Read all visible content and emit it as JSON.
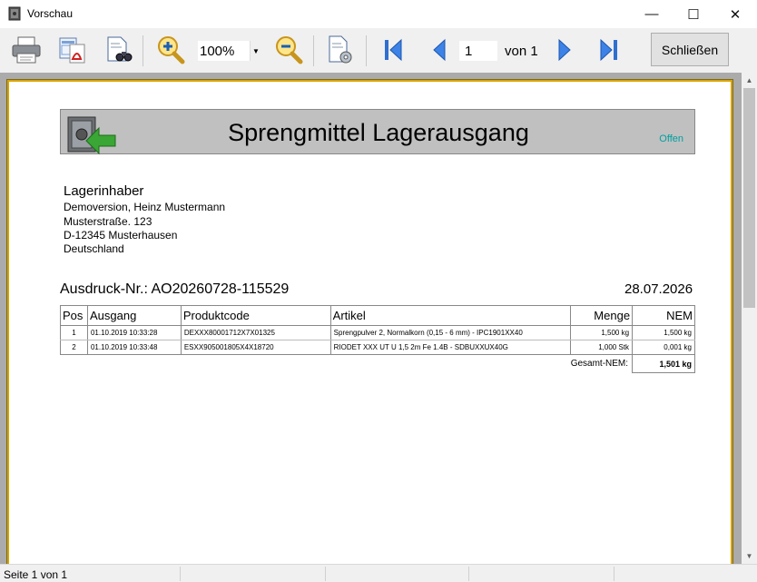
{
  "window": {
    "title": "Vorschau",
    "minimize": "—",
    "maximize": "☐",
    "close": "✕"
  },
  "toolbar": {
    "zoom_value": "100%",
    "page_current": "1",
    "page_of": "von 1",
    "close_label": "Schließen"
  },
  "report": {
    "title": "Sprengmittel Lagerausgang",
    "status": "Offen",
    "address": {
      "heading": "Lagerinhaber",
      "line1": "Demoversion, Heinz Mustermann",
      "line2": "Musterstraße. 123",
      "line3": "D-12345 Musterhausen",
      "line4": "Deutschland"
    },
    "print_no": "Ausdruck-Nr.: AO20260728-115529",
    "date": "28.07.2026",
    "columns": {
      "pos": "Pos",
      "ausgang": "Ausgang",
      "produktcode": "Produktcode",
      "artikel": "Artikel",
      "menge": "Menge",
      "nem": "NEM"
    },
    "rows": [
      {
        "pos": "1",
        "ausgang": "01.10.2019 10:33:28",
        "produktcode": "DEXXX80001712X7X01325",
        "artikel": "Sprengpulver 2, Normalkorn (0,15 - 6 mm) - IPC1901XX40",
        "menge": "1,500 kg",
        "nem": "1,500 kg"
      },
      {
        "pos": "2",
        "ausgang": "01.10.2019 10:33:48",
        "produktcode": "ESXX905001805X4X18720",
        "artikel": "RIODET XXX UT U 1,5 2m Fe 1.4B - SDBUXXUX40G",
        "menge": "1,000 Stk",
        "nem": "0,001 kg"
      }
    ],
    "total_label": "Gesamt-NEM:",
    "total_value": "1,501 kg"
  },
  "statusbar": {
    "text": "Seite 1 von 1"
  }
}
